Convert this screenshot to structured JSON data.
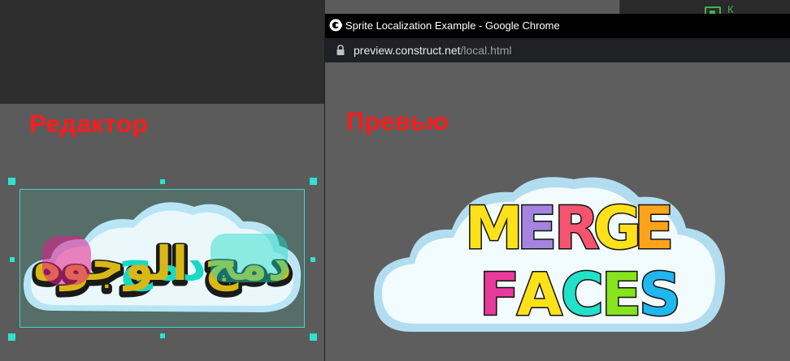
{
  "editor": {
    "title": "Редактор",
    "top_right_label": "К"
  },
  "browser": {
    "window_title": "Sprite Localization Example - Google Chrome",
    "url_host": "preview.construct.net",
    "url_path": "/local.html"
  },
  "preview": {
    "title": "Превью"
  },
  "sprites": {
    "arabic_text": "دمج الوجوه",
    "english_line1": "MERGE",
    "english_line2": "FACES"
  },
  "colors": {
    "heading_red": "#ff1a1a",
    "selection_cyan": "#2de3d0",
    "cloud_fill": "#eef9fb",
    "cloud_rim": "#a9dcf0"
  }
}
